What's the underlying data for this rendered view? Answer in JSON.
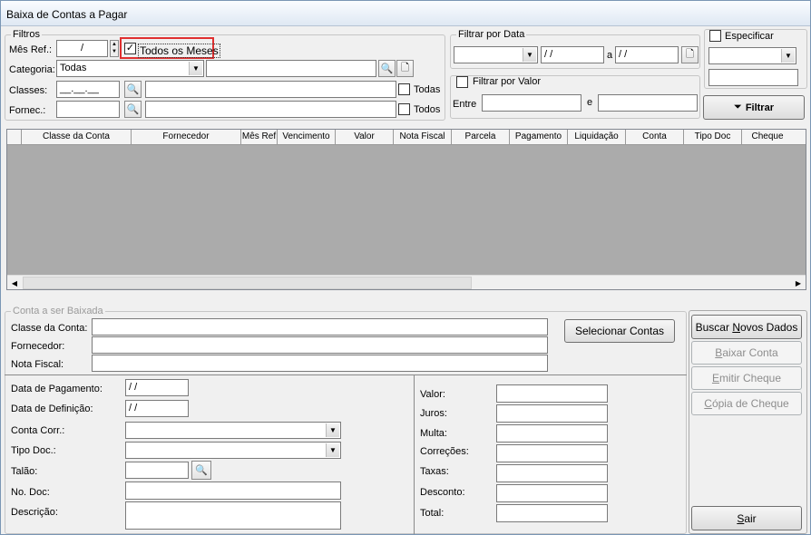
{
  "window": {
    "title": "Baixa de Contas a Pagar"
  },
  "filtros": {
    "legend": "Filtros",
    "mes_ref_label": "Mês Ref.:",
    "mes_ref_value": "/",
    "todos_meses_label": "Todos os Meses",
    "todos_meses_checked": true,
    "categoria_label": "Categoria:",
    "categoria_value": "Todas",
    "classes_label": "Classes:",
    "classes_value": "__.__.__",
    "classes_todas_label": "Todas",
    "fornec_label": "Fornec.:",
    "fornec_todos_label": "Todos"
  },
  "filtrar_data": {
    "legend": "Filtrar por Data",
    "date_from": " / /",
    "a_label": "a",
    "date_to": " / /"
  },
  "filtrar_valor": {
    "label": "Filtrar por Valor",
    "entre_label": "Entre",
    "e_label": "e"
  },
  "especificar": {
    "label": "Especificar"
  },
  "filtrar_button": "Filtrar",
  "grid": {
    "columns": [
      "",
      "Classe da Conta",
      "Fornecedor",
      "Mês Ref",
      "Vencimento",
      "Valor",
      "Nota Fiscal",
      "Parcela",
      "Pagamento",
      "Liquidação",
      "Conta",
      "Tipo Doc",
      "Cheque"
    ]
  },
  "conta_baixada": {
    "legend": "Conta a ser Baixada",
    "classe_label": "Classe da Conta:",
    "fornecedor_label": "Fornecedor:",
    "nota_label": "Nota Fiscal:",
    "selecionar_button": "Selecionar Contas"
  },
  "detalhes": {
    "data_pagamento_label": "Data de Pagamento:",
    "data_pagamento_value": " / /",
    "data_definicao_label": "Data de Definição:",
    "data_definicao_value": " / /",
    "conta_corr_label": "Conta Corr.:",
    "tipo_doc_label": "Tipo Doc.:",
    "talao_label": "Talão:",
    "no_doc_label": "No. Doc:",
    "descricao_label": "Descrição:"
  },
  "valores": {
    "valor_label": "Valor:",
    "juros_label": "Juros:",
    "multa_label": "Multa:",
    "correcoes_label": "Correções:",
    "taxas_label": "Taxas:",
    "desconto_label": "Desconto:",
    "total_label": "Total:"
  },
  "actions": {
    "buscar_pre": "Buscar ",
    "buscar_u": "N",
    "buscar_post": "ovos Dados",
    "baixar_u": "B",
    "baixar_post": "aixar Conta",
    "emitir_u": "E",
    "emitir_post": "mitir Cheque",
    "copia_u": "C",
    "copia_post": "ópia de Cheque",
    "sair_u": "S",
    "sair_post": "air"
  },
  "icons": {
    "search": "binoculars-icon",
    "document": "document-icon",
    "filter": "funnel-icon",
    "dropdown": "chevron-down-icon"
  },
  "colors": {
    "highlight": "#e03030",
    "grid_body": "#ababab"
  }
}
